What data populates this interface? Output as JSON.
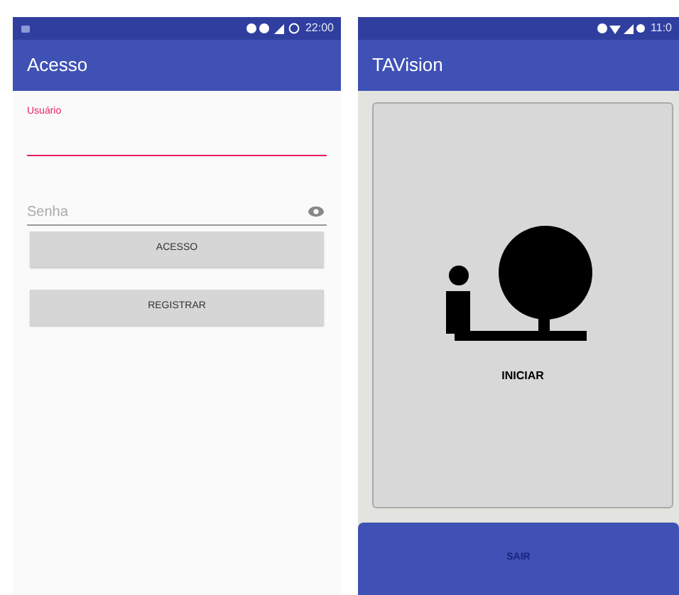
{
  "login_screen": {
    "status_bar": {
      "time": "22:00"
    },
    "app_bar": {
      "title": "Acesso"
    },
    "fields": [
      {
        "kind": "text",
        "label": "Usuário",
        "focused": true
      },
      {
        "kind": "password",
        "placeholder": "Senha",
        "focused": false
      }
    ],
    "buttons": [
      "ACESSO",
      "REGISTRAR"
    ]
  },
  "main_screen": {
    "status_bar": {
      "time": "11:0"
    },
    "app_bar": {
      "title": "TAVision"
    },
    "start_button": {
      "label": "INICIAR"
    },
    "exit_button": {
      "label": "SAIR"
    }
  }
}
